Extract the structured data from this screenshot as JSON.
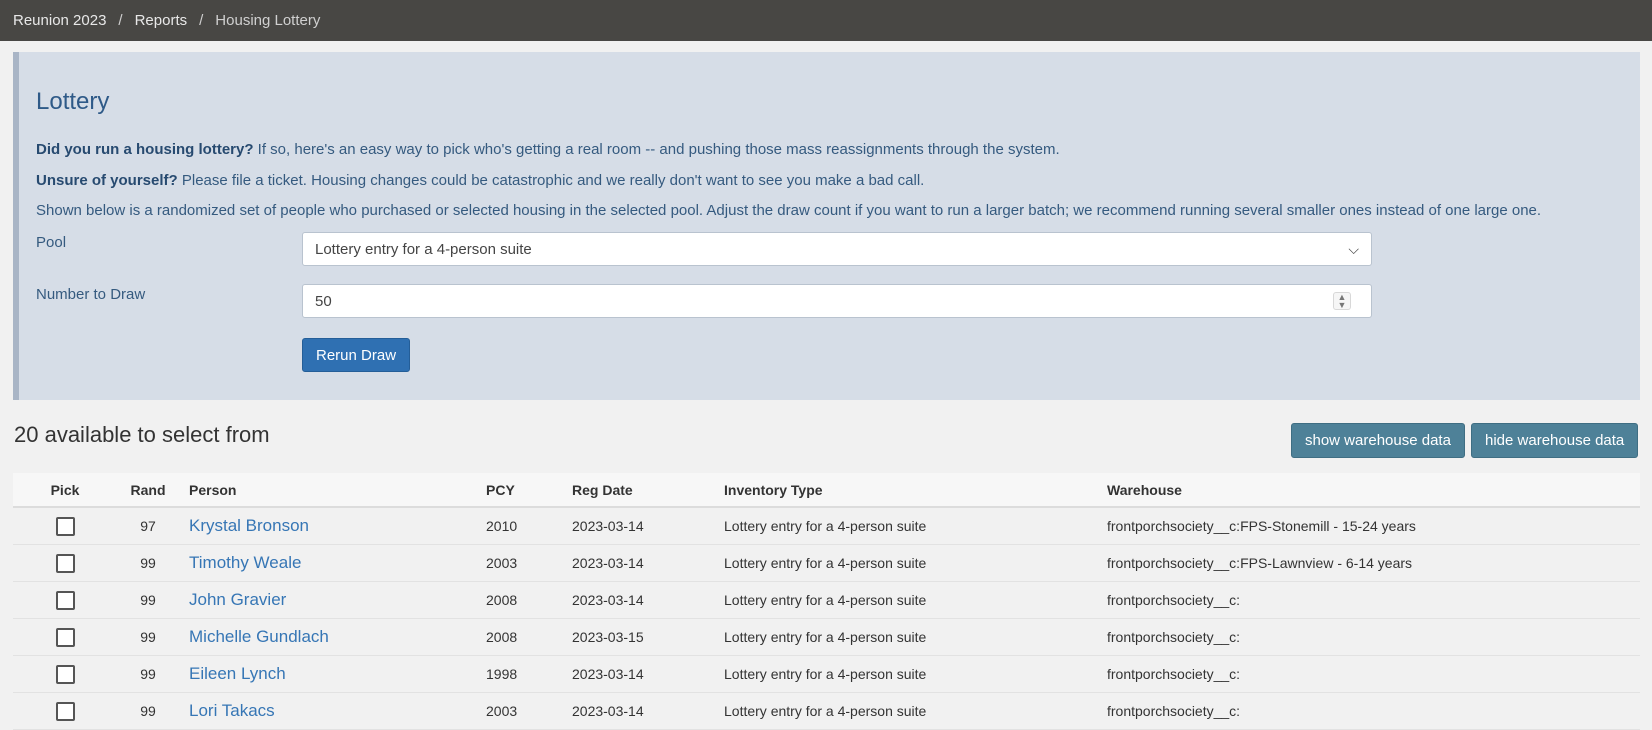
{
  "breadcrumb": [
    "Reunion 2023",
    "Reports",
    "Housing Lottery"
  ],
  "panel": {
    "title": "Lottery",
    "p1_bold": "Did you run a housing lottery?",
    "p1_text": " If so, here's an easy way to pick who's getting a real room -- and pushing those mass reassignments through the system.",
    "p2_bold": "Unsure of yourself?",
    "p2_text": " Please file a ticket. Housing changes could be catastrophic and we really don't want to see you make a bad call.",
    "p3_text": "Shown below is a randomized set of people who purchased or selected housing in the selected pool. Adjust the draw count if you want to run a larger batch; we recommend running several smaller ones instead of one large one.",
    "pool_label": "Pool",
    "pool_value": "Lottery entry for a 4-person suite",
    "draw_label": "Number to Draw",
    "draw_value": "50",
    "rerun_label": "Rerun Draw"
  },
  "results": {
    "title": "20 available to select from",
    "show_warehouse": "show warehouse data",
    "hide_warehouse": "hide warehouse data",
    "columns": [
      "Pick",
      "Rand",
      "Person",
      "PCY",
      "Reg Date",
      "Inventory Type",
      "Warehouse"
    ],
    "rows": [
      {
        "rand": "97",
        "person": "Krystal Bronson",
        "pcy": "2010",
        "reg": "2023-03-14",
        "inv": "Lottery entry for a 4-person suite",
        "wh": "frontporchsociety__c:FPS-Stonemill - 15-24 years"
      },
      {
        "rand": "99",
        "person": "Timothy Weale",
        "pcy": "2003",
        "reg": "2023-03-14",
        "inv": "Lottery entry for a 4-person suite",
        "wh": "frontporchsociety__c:FPS-Lawnview - 6-14 years"
      },
      {
        "rand": "99",
        "person": "John Gravier",
        "pcy": "2008",
        "reg": "2023-03-14",
        "inv": "Lottery entry for a 4-person suite",
        "wh": "frontporchsociety__c:"
      },
      {
        "rand": "99",
        "person": "Michelle Gundlach",
        "pcy": "2008",
        "reg": "2023-03-15",
        "inv": "Lottery entry for a 4-person suite",
        "wh": "frontporchsociety__c:"
      },
      {
        "rand": "99",
        "person": "Eileen Lynch",
        "pcy": "1998",
        "reg": "2023-03-14",
        "inv": "Lottery entry for a 4-person suite",
        "wh": "frontporchsociety__c:"
      },
      {
        "rand": "99",
        "person": "Lori Takacs",
        "pcy": "2003",
        "reg": "2023-03-14",
        "inv": "Lottery entry for a 4-person suite",
        "wh": "frontporchsociety__c:"
      }
    ]
  }
}
